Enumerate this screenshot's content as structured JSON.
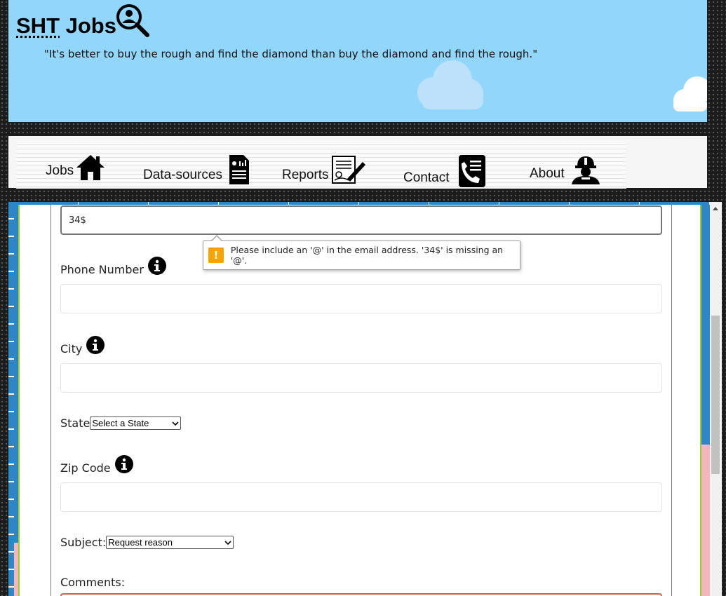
{
  "header": {
    "logo_abbr": "SHT",
    "logo_rest": " Jobs",
    "quote": "\"It's better to buy the rough and find the diamond than buy the diamond and find the rough.\""
  },
  "nav": {
    "items": [
      {
        "label": "Jobs",
        "icon": "house-icon"
      },
      {
        "label": "Data-sources",
        "icon": "document-chart-icon"
      },
      {
        "label": "Reports",
        "icon": "report-pen-icon"
      },
      {
        "label": "Contact",
        "icon": "phone-contact-icon"
      },
      {
        "label": "About",
        "icon": "worker-icon"
      }
    ]
  },
  "form": {
    "email_value": "34$",
    "email_error": "Please include an '@' in the email address. '34$' is missing an '@'.",
    "phone_label": "Phone Number",
    "city_label": "City",
    "state_label": "State",
    "state_selected": "Select a State",
    "zip_label": "Zip Code",
    "subject_label": "Subject:",
    "subject_selected": "Request reason",
    "comments_label": "Comments:"
  },
  "colors": {
    "header_bg": "#92d6fb",
    "main_bg": "#2f86c5",
    "warning": "#f5a500",
    "error_border": "#d95a4a"
  }
}
